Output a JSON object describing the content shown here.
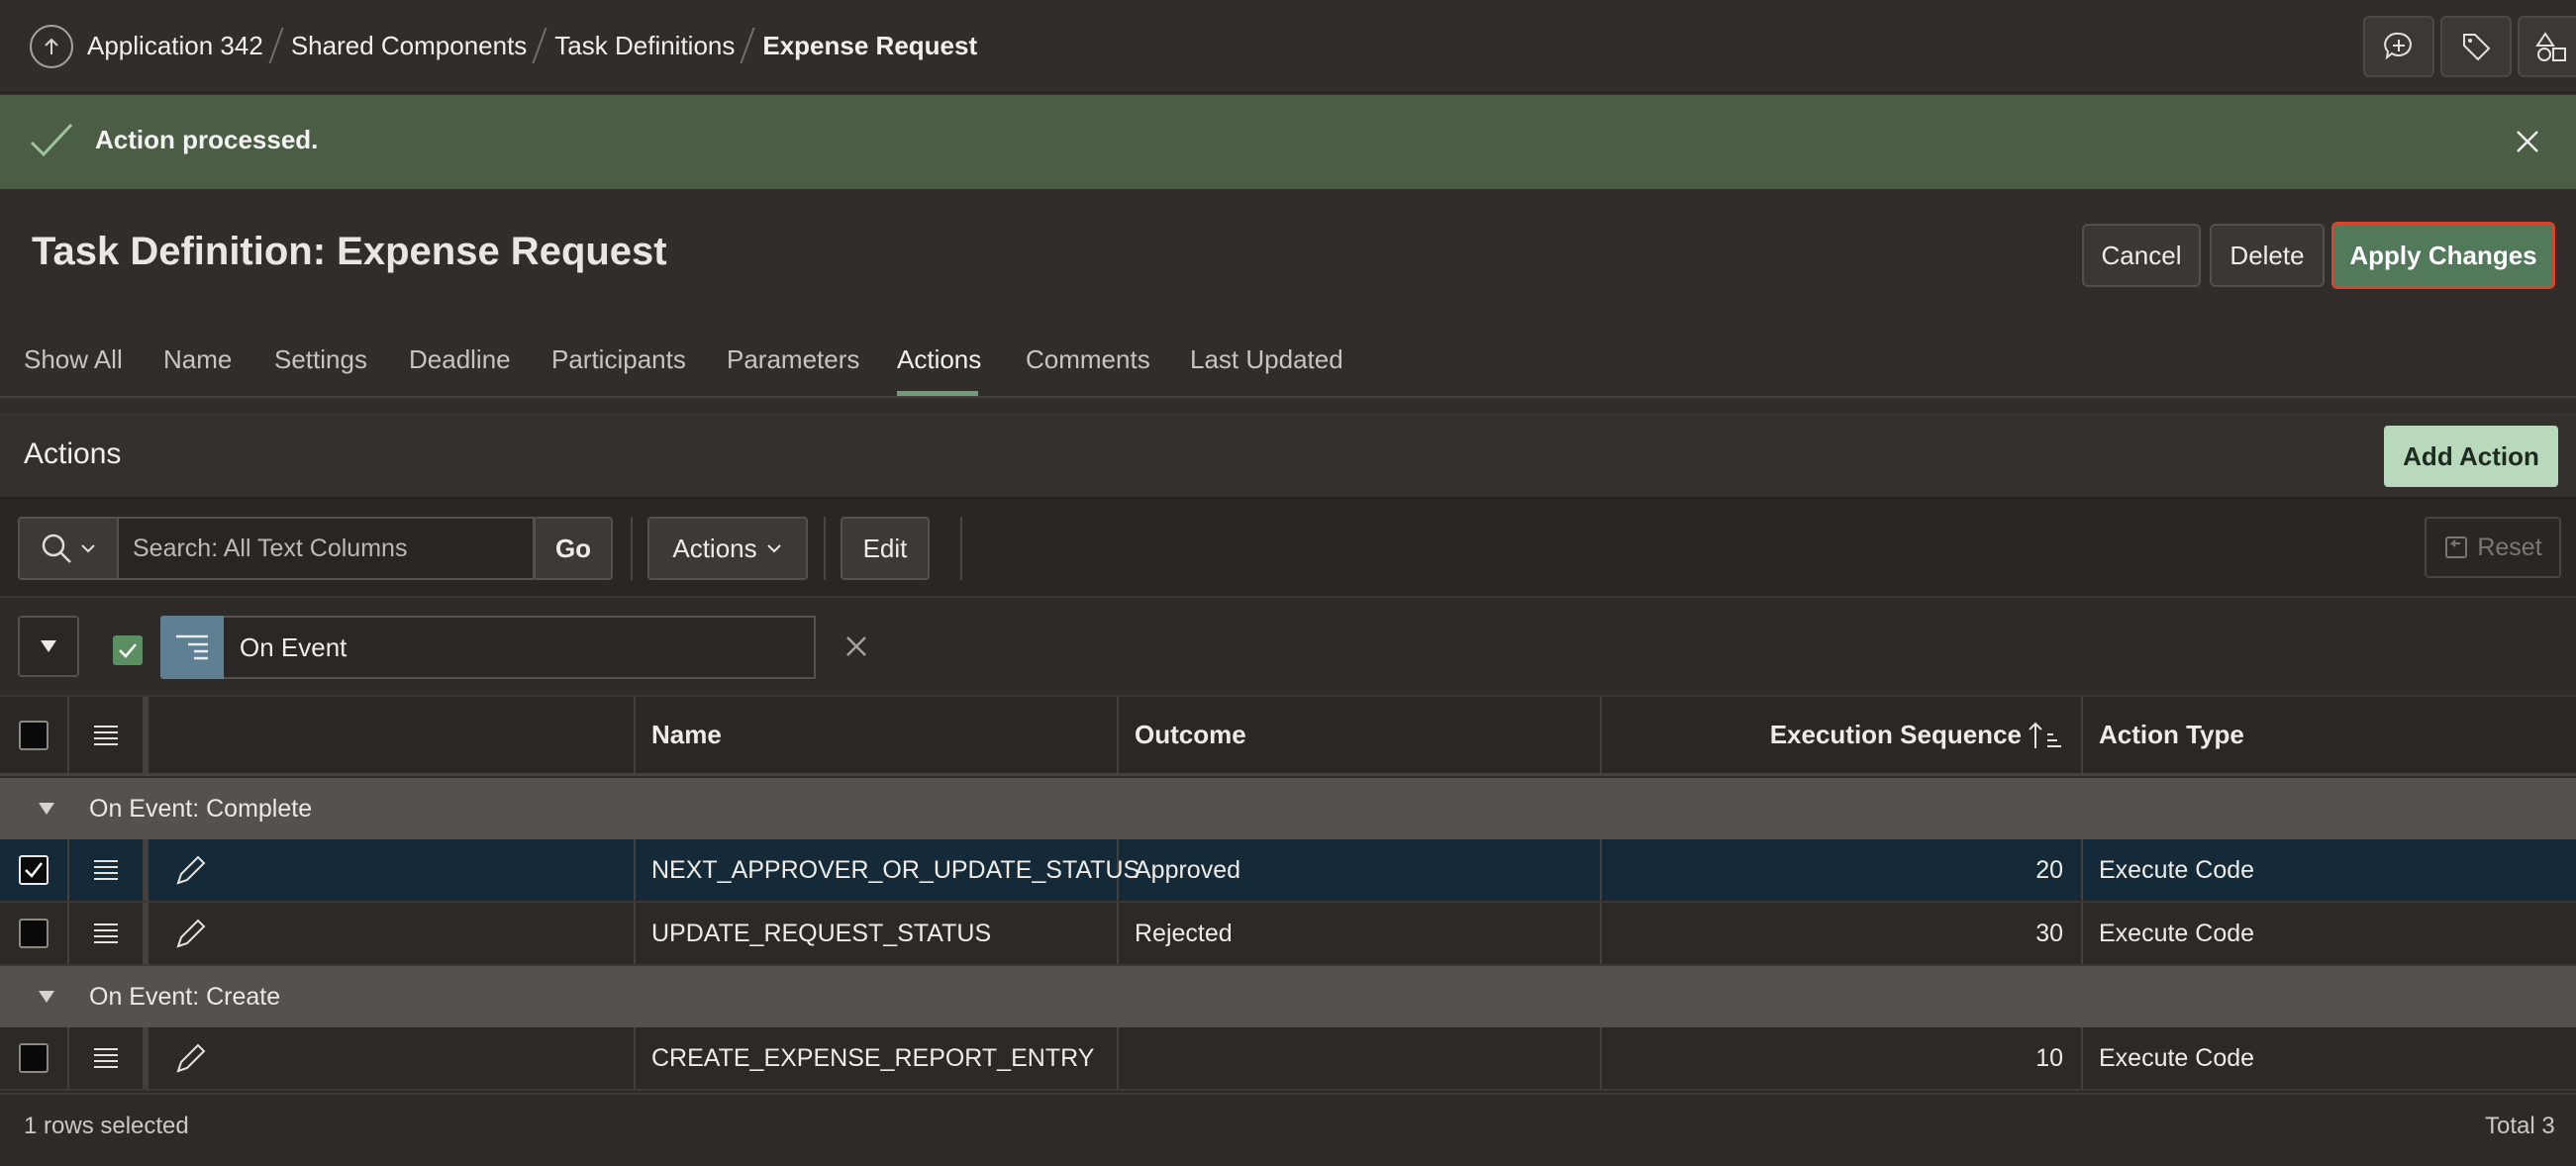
{
  "breadcrumb": {
    "items": [
      "Application 342",
      "Shared Components",
      "Task Definitions"
    ],
    "current": "Expense Request"
  },
  "top_icons": [
    "comment-plus-icon",
    "tag-icon",
    "shapes-icon"
  ],
  "banner": {
    "message": "Action processed."
  },
  "page": {
    "title": "Task Definition: Expense Request",
    "cancel_label": "Cancel",
    "delete_label": "Delete",
    "apply_label": "Apply Changes"
  },
  "tabs": [
    "Show All",
    "Name",
    "Settings",
    "Deadline",
    "Participants",
    "Parameters",
    "Actions",
    "Comments",
    "Last Updated"
  ],
  "active_tab": "Actions",
  "region": {
    "title": "Actions",
    "add_label": "Add Action"
  },
  "toolbar": {
    "search_placeholder": "Search: All Text Columns",
    "go_label": "Go",
    "actions_label": "Actions",
    "edit_label": "Edit",
    "reset_label": "Reset"
  },
  "filter": {
    "label": "On Event"
  },
  "grid": {
    "columns": [
      "Name",
      "Outcome",
      "Execution Sequence",
      "Action Type"
    ],
    "groups": [
      {
        "label": "On Event: Complete",
        "rows": [
          {
            "selected": true,
            "name": "NEXT_APPROVER_OR_UPDATE_STATUS",
            "outcome": "Approved",
            "sequence": "20",
            "type": "Execute Code"
          },
          {
            "selected": false,
            "name": "UPDATE_REQUEST_STATUS",
            "outcome": "Rejected",
            "sequence": "30",
            "type": "Execute Code"
          }
        ]
      },
      {
        "label": "On Event: Create",
        "rows": [
          {
            "selected": false,
            "name": "CREATE_EXPENSE_REPORT_ENTRY",
            "outcome": "",
            "sequence": "10",
            "type": "Execute Code"
          }
        ]
      }
    ]
  },
  "footer": {
    "selected_text": "1 rows selected",
    "total_text": "Total 3"
  },
  "colors": {
    "banner": "#4b5d44",
    "primary": "#52795a",
    "selected_row": "#152a38",
    "group_row": "#57514d"
  }
}
